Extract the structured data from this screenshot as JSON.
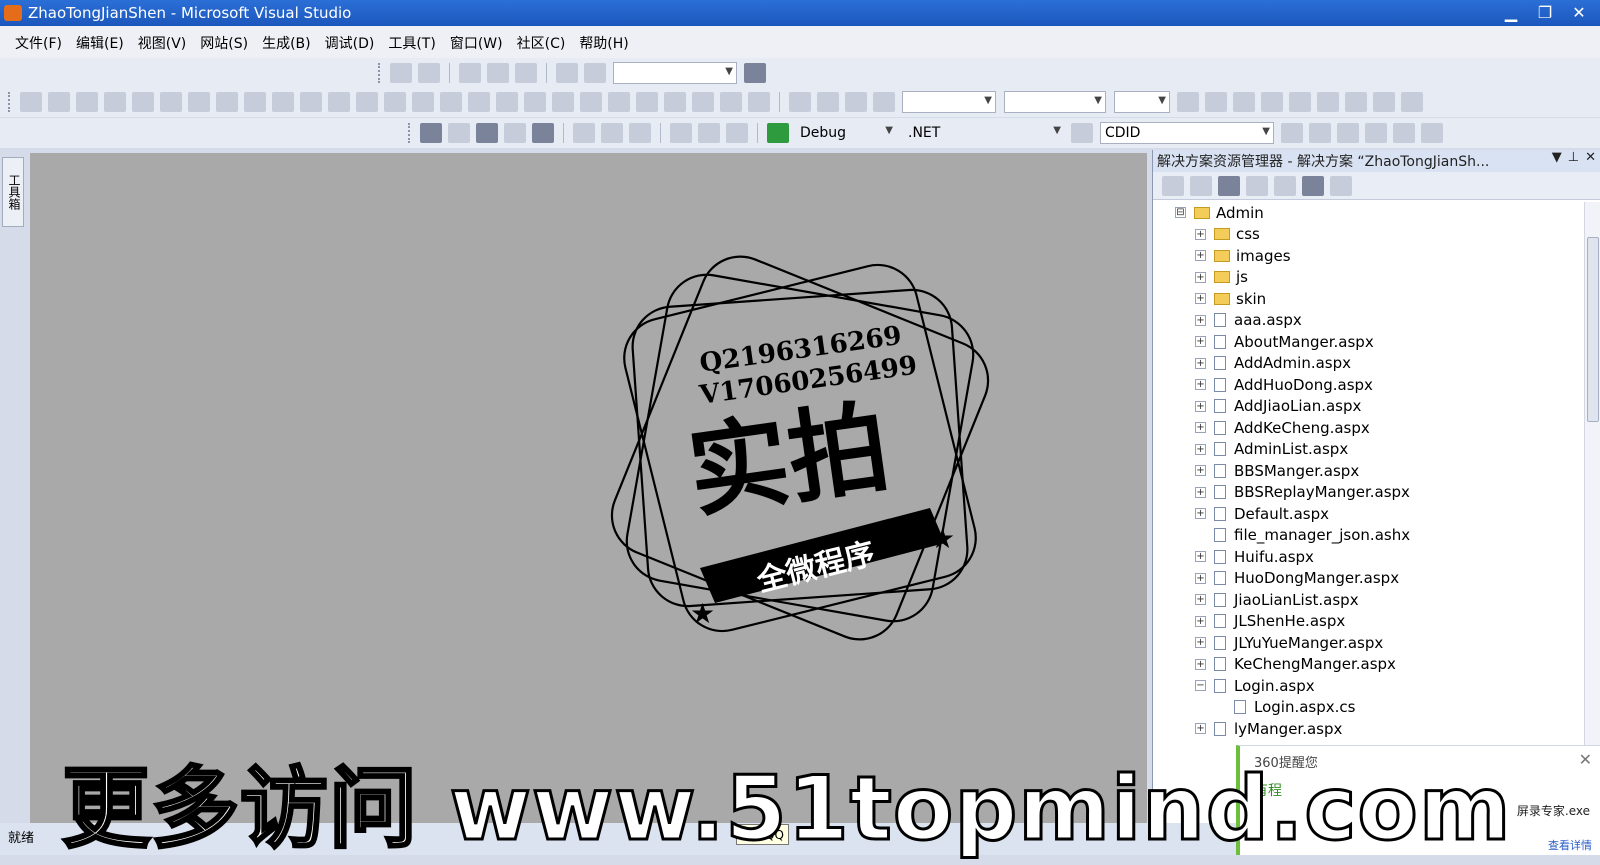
{
  "window": {
    "title": "ZhaoTongJianShen - Microsoft Visual Studio",
    "controls": [
      "▁",
      "❐",
      "✕"
    ]
  },
  "menu": [
    "文件(F)",
    "编辑(E)",
    "视图(V)",
    "网站(S)",
    "生成(B)",
    "调试(D)",
    "工具(T)",
    "窗口(W)",
    "社区(C)",
    "帮助(H)"
  ],
  "toolbar3": {
    "config": "Debug",
    "platform": ".NET",
    "find": "CDID"
  },
  "toolbox_tab": "工具箱",
  "stamp": {
    "line1": "Q2196316269",
    "line2": "V17060256499",
    "main": "实拍",
    "banner": "全微程序"
  },
  "solution": {
    "header": "解决方案资源管理器 - 解决方案 “ZhaoTongJianSh...",
    "tree": [
      {
        "label": "Admin",
        "type": "folder",
        "level": 0,
        "expander": "⊟"
      },
      {
        "label": "css",
        "type": "folder",
        "level": 1,
        "expander": "+"
      },
      {
        "label": "images",
        "type": "folder",
        "level": 1,
        "expander": "+"
      },
      {
        "label": "js",
        "type": "folder",
        "level": 1,
        "expander": "+"
      },
      {
        "label": "skin",
        "type": "folder",
        "level": 1,
        "expander": "+"
      },
      {
        "label": "aaa.aspx",
        "type": "file",
        "level": 1,
        "expander": "+"
      },
      {
        "label": "AboutManger.aspx",
        "type": "file",
        "level": 1,
        "expander": "+"
      },
      {
        "label": "AddAdmin.aspx",
        "type": "file",
        "level": 1,
        "expander": "+"
      },
      {
        "label": "AddHuoDong.aspx",
        "type": "file",
        "level": 1,
        "expander": "+"
      },
      {
        "label": "AddJiaoLian.aspx",
        "type": "file",
        "level": 1,
        "expander": "+"
      },
      {
        "label": "AddKeCheng.aspx",
        "type": "file",
        "level": 1,
        "expander": "+"
      },
      {
        "label": "AdminList.aspx",
        "type": "file",
        "level": 1,
        "expander": "+"
      },
      {
        "label": "BBSManger.aspx",
        "type": "file",
        "level": 1,
        "expander": "+"
      },
      {
        "label": "BBSReplayManger.aspx",
        "type": "file",
        "level": 1,
        "expander": "+"
      },
      {
        "label": "Default.aspx",
        "type": "file",
        "level": 1,
        "expander": "+"
      },
      {
        "label": "file_manager_json.ashx",
        "type": "file",
        "level": 1,
        "expander": ""
      },
      {
        "label": "Huifu.aspx",
        "type": "file",
        "level": 1,
        "expander": "+"
      },
      {
        "label": "HuoDongManger.aspx",
        "type": "file",
        "level": 1,
        "expander": "+"
      },
      {
        "label": "JiaoLianList.aspx",
        "type": "file",
        "level": 1,
        "expander": "+"
      },
      {
        "label": "JLShenHe.aspx",
        "type": "file",
        "level": 1,
        "expander": "+"
      },
      {
        "label": "JLYuYueManger.aspx",
        "type": "file",
        "level": 1,
        "expander": "+"
      },
      {
        "label": "KeChengManger.aspx",
        "type": "file",
        "level": 1,
        "expander": "+"
      },
      {
        "label": "Login.aspx",
        "type": "file",
        "level": 1,
        "expander": "−"
      },
      {
        "label": "Login.aspx.cs",
        "type": "file",
        "level": 2,
        "expander": ""
      },
      {
        "label": "lyManger.aspx",
        "type": "file",
        "level": 1,
        "expander": "+"
      }
    ]
  },
  "notification": {
    "title": "360提醒您",
    "text": "有程",
    "file": "屏录专家.exe",
    "link": "查看详情",
    "close": "✕"
  },
  "status": "就绪",
  "taskbar_tip": "腾讯QQ",
  "watermark": "更多访问 www.51topmind.com"
}
